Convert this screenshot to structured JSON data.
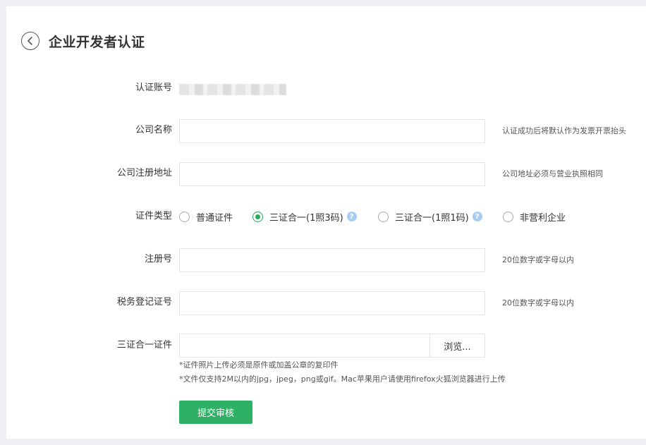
{
  "header": {
    "title": "企业开发者认证"
  },
  "form": {
    "account": {
      "label": "认证账号"
    },
    "company_name": {
      "label": "公司名称",
      "value": "",
      "hint": "认证成功后将默认作为发票开票抬头"
    },
    "company_address": {
      "label": "公司注册地址",
      "value": "",
      "hint": "公司地址必须与营业执照相同"
    },
    "cert_type": {
      "label": "证件类型",
      "options": [
        {
          "label": "普通证件",
          "checked": false,
          "help": false
        },
        {
          "label": "三证合一(1照3码)",
          "checked": true,
          "help": true
        },
        {
          "label": "三证合一(1照1码)",
          "checked": false,
          "help": true
        },
        {
          "label": "非营利企业",
          "checked": false,
          "help": false
        }
      ]
    },
    "reg_number": {
      "label": "注册号",
      "value": "",
      "hint": "20位数字或字母以内"
    },
    "tax_number": {
      "label": "税务登记证号",
      "value": "",
      "hint": "20位数字或字母以内"
    },
    "certificate": {
      "label": "三证合一证件",
      "browse_label": "浏览...",
      "notes": [
        "*证件照片上传必须是原件或加盖公章的复印件",
        "*文件仅支持2M以内的jpg，jpeg，png或gif。Mac苹果用户请使用firefox火狐浏览器进行上传"
      ]
    },
    "submit_label": "提交审核"
  },
  "colors": {
    "accent": "#2eb065",
    "radio_checked": "#2ba85b",
    "help_icon": "#a9cdf0"
  },
  "icons": {
    "back": "chevron-left-icon",
    "help": "question-icon"
  }
}
